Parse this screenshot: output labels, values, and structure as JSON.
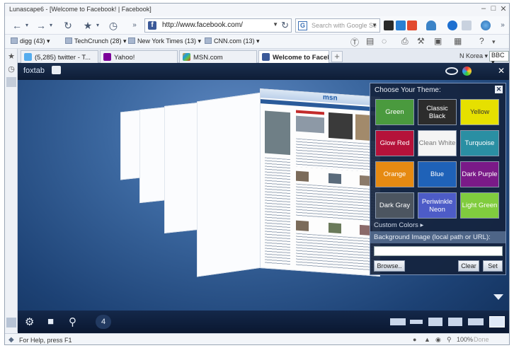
{
  "window": {
    "title": "Lunascape6 - [Welcome to Facebook! | Facebook]"
  },
  "address": {
    "url": "http://www.facebook.com/",
    "favicon": "f"
  },
  "search": {
    "placeholder": "Search with Google Se"
  },
  "bookmarks": [
    {
      "label": "digg (43)"
    },
    {
      "label": "TechCrunch (28)"
    },
    {
      "label": "New York Times (13)"
    },
    {
      "label": "CNN.com (13)"
    }
  ],
  "tabs": [
    {
      "label": "(5,285) twitter - T..."
    },
    {
      "label": "Yahoo!"
    },
    {
      "label": "MSN.com"
    },
    {
      "label": "Welcome to Faceb..."
    }
  ],
  "region": {
    "label": "N Korea",
    "news": "BBC"
  },
  "foxtab": {
    "logo": "foxtab",
    "tab_count": "4",
    "msn_logo": "msn",
    "theme_panel": {
      "title": "Choose Your Theme:",
      "themes": [
        {
          "label": "Green",
          "bg": "#4a9a3e",
          "fg": "#ffffff"
        },
        {
          "label": "Classic Black",
          "bg": "#2c2c2c",
          "fg": "#ffffff"
        },
        {
          "label": "Yellow",
          "bg": "#e6e000",
          "fg": "#333333"
        },
        {
          "label": "Glow Red",
          "bg": "#b5123a",
          "fg": "#ffffff"
        },
        {
          "label": "Clean White",
          "bg": "#f4f4f4",
          "fg": "#777777"
        },
        {
          "label": "Turquoise",
          "bg": "#2a8fa3",
          "fg": "#ffffff"
        },
        {
          "label": "Orange",
          "bg": "#e68a12",
          "fg": "#ffffff"
        },
        {
          "label": "Blue",
          "bg": "#1f62b8",
          "fg": "#ffffff"
        },
        {
          "label": "Dark Purple",
          "bg": "#7a1a88",
          "fg": "#ffffff"
        },
        {
          "label": "Dark Gray",
          "bg": "#4c5560",
          "fg": "#ffffff"
        },
        {
          "label": "Periwinkle Neon",
          "bg": "#4d5cc7",
          "fg": "#ffffff"
        },
        {
          "label": "Light Green",
          "bg": "#80cc3e",
          "fg": "#ffffff"
        }
      ],
      "custom_colors": "Custom Colors",
      "bg_image_label": "Background Image (local path or URL):",
      "bg_image_value": "",
      "browse": "Browse..",
      "clear": "Clear",
      "set": "Set"
    }
  },
  "status": {
    "text": "For Help, press F1",
    "zoom": "100%",
    "done": "Done"
  },
  "colors": {
    "accent": "#3b5998",
    "panel": "#14243e"
  }
}
